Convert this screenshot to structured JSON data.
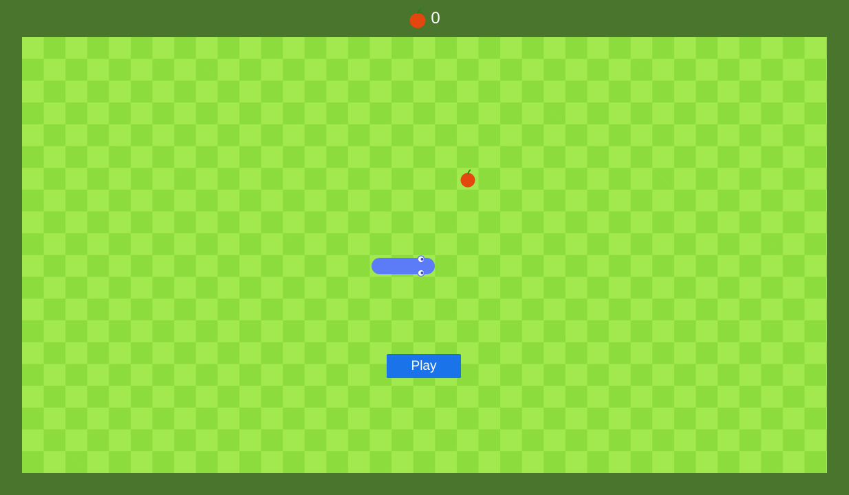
{
  "header": {
    "score_icon": "apple-icon",
    "score": "0"
  },
  "board": {
    "colors": {
      "light": "#a2e84f",
      "dark": "#8cdc3d",
      "frame": "#4a752c",
      "snake": "#5b7bf7",
      "apple": "#e3460e",
      "stem": "#2c7d1a"
    },
    "snake": {
      "direction": "right",
      "length_cells": 3
    },
    "apple_icon": "apple-icon"
  },
  "controls": {
    "play_label": "Play",
    "play_color": "#1a73e8"
  }
}
